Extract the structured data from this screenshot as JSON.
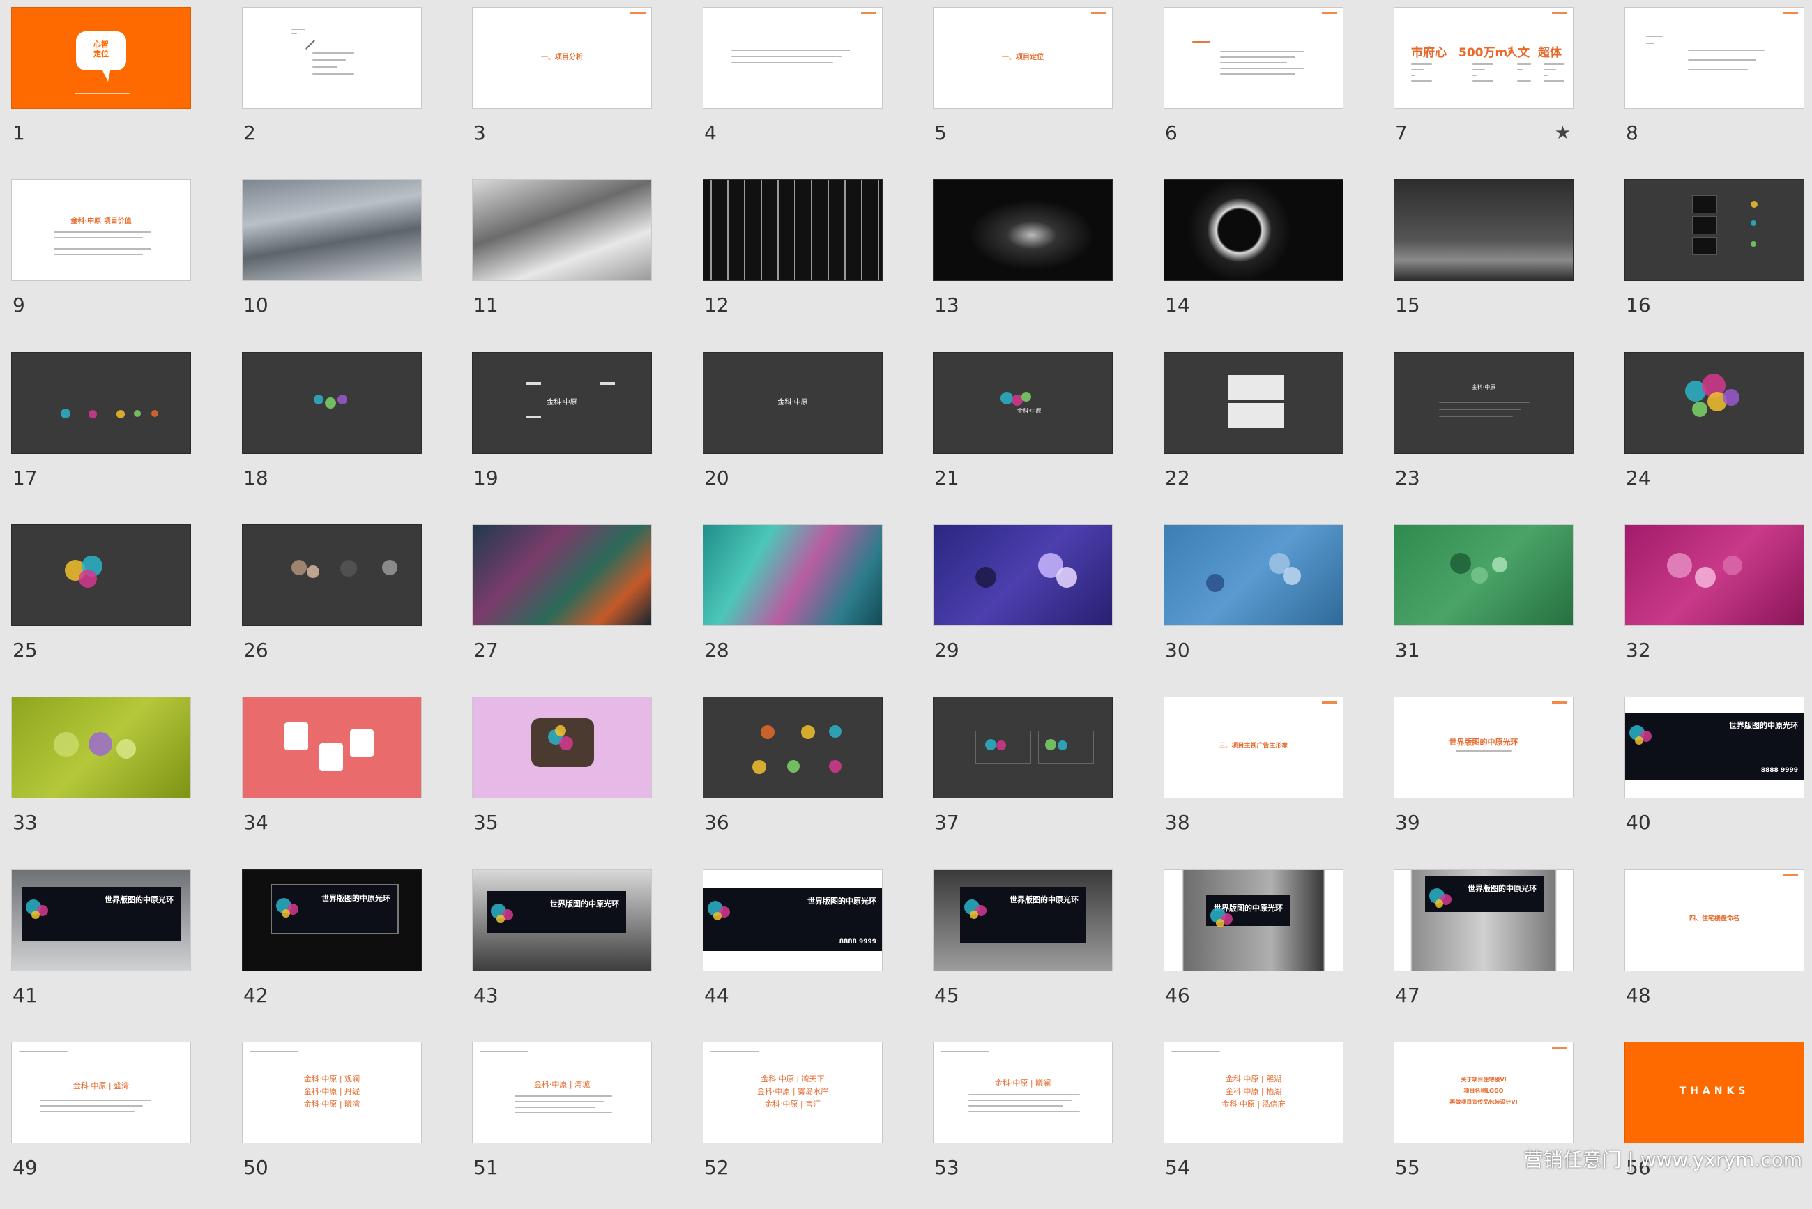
{
  "slide_numbers": [
    "1",
    "2",
    "3",
    "4",
    "5",
    "6",
    "7",
    "8",
    "9",
    "10",
    "11",
    "12",
    "13",
    "14",
    "15",
    "16",
    "17",
    "18",
    "19",
    "20",
    "21",
    "22",
    "23",
    "24",
    "25",
    "26",
    "27",
    "28",
    "29",
    "30",
    "31",
    "32",
    "33",
    "34",
    "35",
    "36",
    "37",
    "38",
    "39",
    "40",
    "41",
    "42",
    "43",
    "44",
    "45",
    "46",
    "47",
    "48",
    "49",
    "50",
    "51",
    "52",
    "53",
    "54",
    "55",
    "56"
  ],
  "thumb_text": {
    "s1_logo": "心智\n定位",
    "s3_title": "一、项目分析",
    "s5_title": "一、项目定位",
    "s7_words": [
      "市府心",
      "500万m²",
      "人文",
      "超体"
    ],
    "s9_title": "金科·中原 项目价值",
    "s19_brand": "金科·中原",
    "s20_brand": "金科·中原",
    "s21_brand": "金科·中原",
    "s23_brand": "金科·中原",
    "s38_title": "三、项目主视广告主形象",
    "s39_title": "世界版图的中原光环",
    "s40_headline": "世界版图的中原光环",
    "s40_phone": "8888 9999",
    "s41_headline": "世界版图的中原光环",
    "s42_headline": "世界版图的中原光环",
    "s43_headline": "世界版图的中原光环",
    "s44_headline": "世界版图的中原光环",
    "s44_phone": "8888 9999",
    "s45_headline": "世界版图的中原光环",
    "s46_headline": "世界版图的中原光环",
    "s47_headline": "世界版图的中原光环",
    "s48_title": "四、住宅楼盘命名",
    "s49_title": "金科·中原 | 盛湾",
    "s50_titles": [
      "金科·中原 | 观澜",
      "金科·中原 | 丹缇",
      "金科·中原 | 曦湾"
    ],
    "s51_title": "金科·中原 | 湾城",
    "s52_titles": [
      "金科·中原 | 湾天下",
      "金科·中原 | 雾岛水岸",
      "金科·中原 | 言汇"
    ],
    "s53_title": "金科·中原 | 曦澜",
    "s54_titles": [
      "金科·中原 | 熙湖",
      "金科·中原 | 栖湖",
      "金科·中原 | 泓信府"
    ],
    "s55_titles": [
      "关于项目住宅楼VI",
      "项目名称LOGO",
      "再做项目宣传品包装设计VI"
    ],
    "s56_title": "THANKS"
  },
  "watermark": "营销任意门 | www.yxrym.com",
  "colors": {
    "background": "#e6e6e6",
    "accent_orange": "#ff6a00",
    "title_orange": "#e7692b",
    "dark_slide": "#3a3a3a"
  },
  "icons": {
    "slide7_marker": "star-icon"
  }
}
